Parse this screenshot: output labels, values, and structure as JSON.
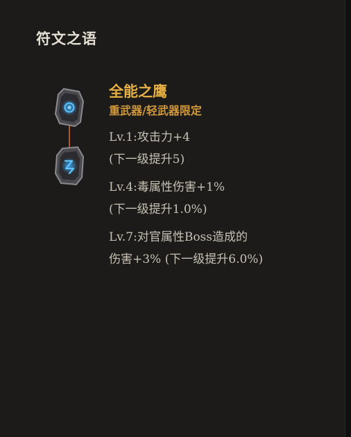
{
  "panel": {
    "title": "符文之语"
  },
  "runeword": {
    "name": "全能之鹰",
    "restriction": "重武器/轻武器限定",
    "runes": [
      {
        "icon": "circle-rune-icon",
        "glow": "#1f8ad8"
      },
      {
        "icon": "zigzag-rune-icon",
        "glow": "#1f8ad8"
      }
    ],
    "connector_color": "#b0572c",
    "levels": [
      {
        "effect": "Lv.1:攻击力+4",
        "next": "(下一级提升5)"
      },
      {
        "effect": "Lv.4:毒属性伤害+1%",
        "next": "(下一级提升1.0%)"
      },
      {
        "effect": "Lv.7:对官属性Boss造成的",
        "next": "伤害+3% (下一级提升6.0%)"
      }
    ]
  },
  "colors": {
    "title": "#e6e0d4",
    "name": "#e6b043",
    "restriction": "#d1983b",
    "body_text": "#c7c1b5",
    "background": "#1c1b19"
  }
}
